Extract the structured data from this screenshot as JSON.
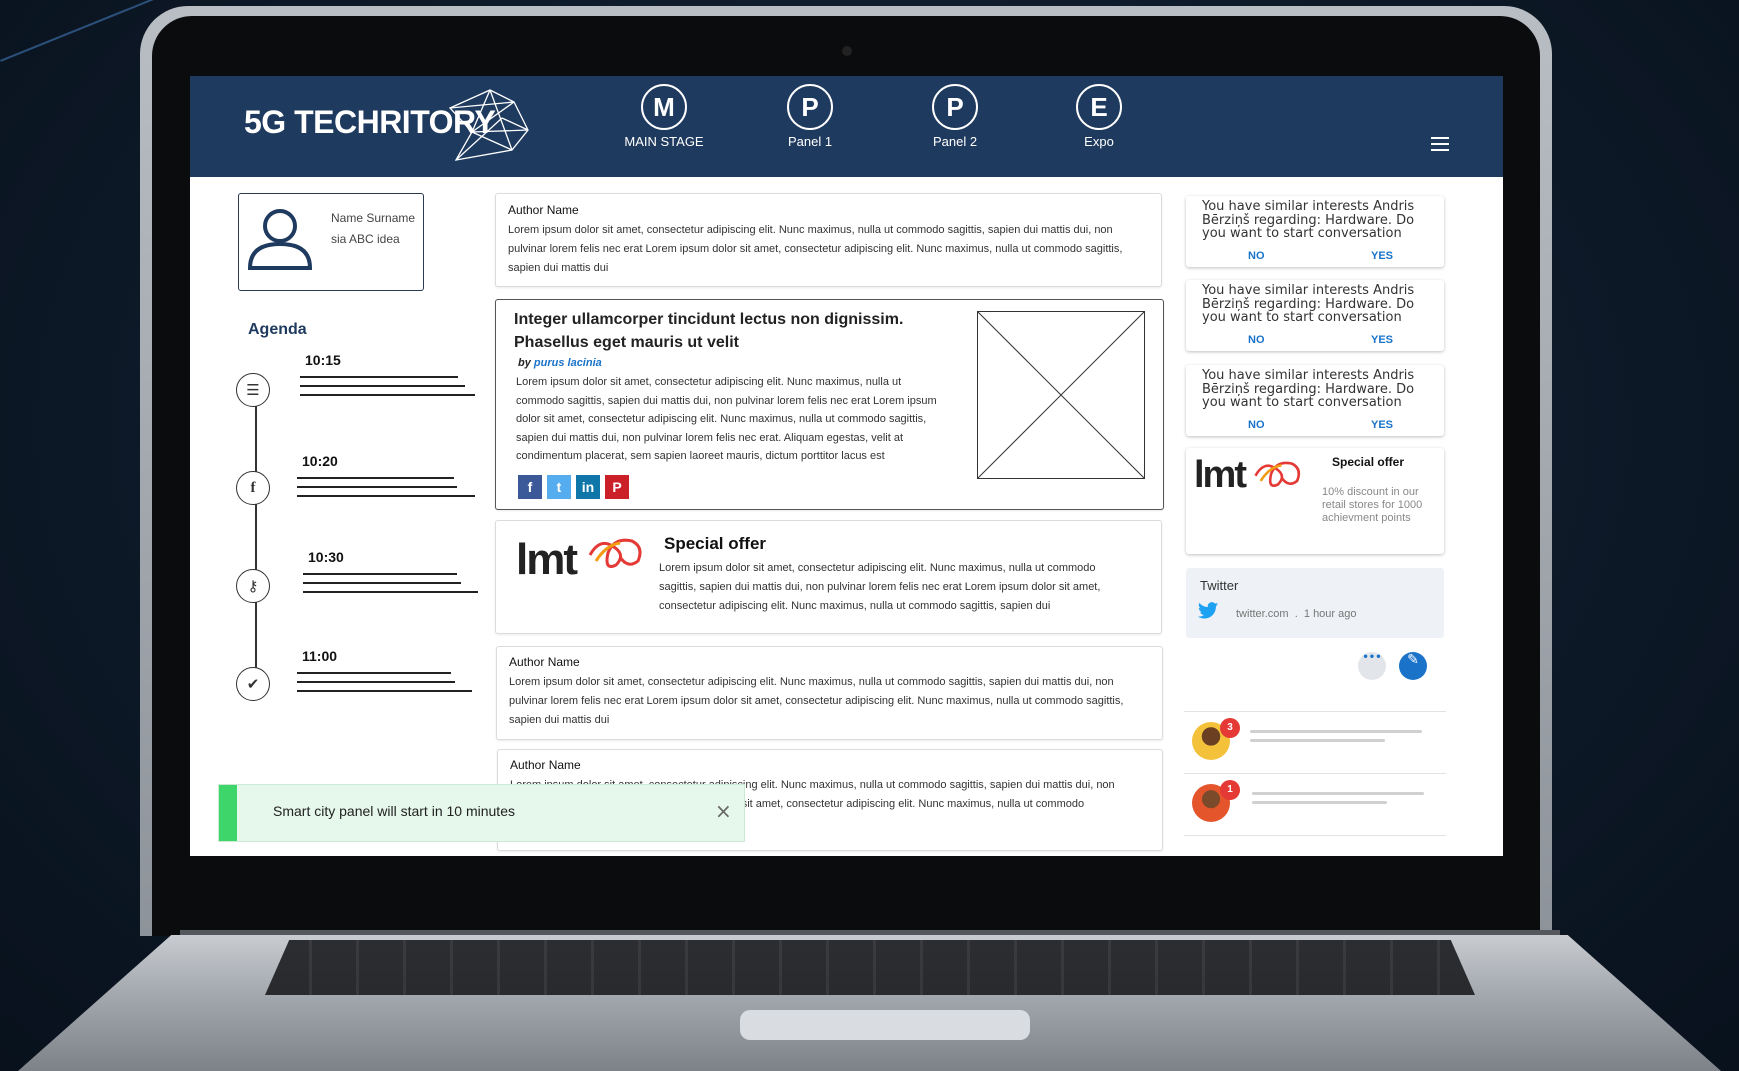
{
  "header": {
    "logo": "5G TECHRITORY",
    "nav": [
      {
        "letter": "M",
        "label": "MAIN STAGE"
      },
      {
        "letter": "P",
        "label": "Panel 1"
      },
      {
        "letter": "P",
        "label": "Panel 2"
      },
      {
        "letter": "E",
        "label": "Expo"
      }
    ],
    "menu_icon": "hamburger-icon"
  },
  "profile": {
    "name": "Name Surname",
    "company": "sia ABC idea",
    "icon": "user-icon"
  },
  "agenda": {
    "title": "Agenda",
    "items": [
      {
        "time": "10:15",
        "icon": "list-icon"
      },
      {
        "time": "10:20",
        "icon": "facebook-icon"
      },
      {
        "time": "10:30",
        "icon": "key-icon"
      },
      {
        "time": "11:00",
        "icon": "check-icon"
      }
    ]
  },
  "feed": {
    "post1": {
      "author": "Author Name",
      "text": "Lorem ipsum dolor sit amet, consectetur adipiscing elit. Nunc maximus, nulla ut commodo sagittis, sapien dui mattis dui, non pulvinar lorem felis nec erat Lorem ipsum dolor sit amet, consectetur adipiscing elit. Nunc maximus, nulla ut commodo sagittis, sapien dui mattis dui"
    },
    "featured": {
      "title": "Integer ullamcorper tincidunt lectus non dignissim. Phasellus eget mauris ut velit",
      "by": "by",
      "author": "purus lacinia",
      "text": "Lorem ipsum dolor sit amet, consectetur adipiscing elit. Nunc maximus, nulla ut commodo sagittis, sapien dui mattis dui, non pulvinar lorem felis nec erat Lorem ipsum dolor sit amet, consectetur adipiscing elit. Nunc maximus, nulla ut commodo sagittis, sapien dui mattis dui, non pulvinar lorem felis nec erat. Aliquam egestas, velit at condimentum placerat, sem sapien laoreet mauris, dictum porttitor lacus est",
      "social": [
        {
          "label": "f",
          "color": "#3b5998",
          "icon": "facebook-icon"
        },
        {
          "label": "t",
          "color": "#55acee",
          "icon": "twitter-icon"
        },
        {
          "label": "in",
          "color": "#0e76a8",
          "icon": "linkedin-icon"
        },
        {
          "label": "P",
          "color": "#cb2027",
          "icon": "pinterest-icon"
        }
      ]
    },
    "offer": {
      "brand": "lmt",
      "title": "Special offer",
      "text": "Lorem ipsum dolor sit amet, consectetur adipiscing elit. Nunc maximus, nulla ut commodo sagittis, sapien dui mattis dui, non pulvinar lorem felis nec erat Lorem ipsum dolor sit amet, consectetur adipiscing elit. Nunc maximus, nulla ut commodo sagittis, sapien dui"
    },
    "post2": {
      "author": "Author Name",
      "text": "Lorem ipsum dolor sit amet, consectetur adipiscing elit. Nunc maximus, nulla ut commodo sagittis, sapien dui mattis dui, non pulvinar lorem felis nec erat Lorem ipsum dolor sit amet, consectetur adipiscing elit. Nunc maximus, nulla ut commodo sagittis, sapien dui mattis dui"
    },
    "post3": {
      "author": "Author Name",
      "text": "Lorem ipsum dolor sit amet, consectetur adipiscing elit. Nunc maximus, nulla ut commodo sagittis, sapien dui mattis dui, non pulvinar lorem felis nec erat Lorem ipsum dolor sit amet, consectetur adipiscing elit. Nunc maximus, nulla ut commodo"
    }
  },
  "toast": {
    "text": "Smart city panel will start in 10 minutes",
    "close": "×"
  },
  "suggestions": [
    {
      "text": "You have similar interests Andris Bērziņš regarding: Hardware. Do you want to start conversation",
      "no": "NO",
      "yes": "YES"
    },
    {
      "text": "You have similar interests Andris Bērziņš regarding: Hardware. Do you want to start conversation",
      "no": "NO",
      "yes": "YES"
    },
    {
      "text": "You have similar interests Andris Bērziņš regarding: Hardware. Do you want to start conversation",
      "no": "NO",
      "yes": "YES"
    }
  ],
  "side_offer": {
    "brand": "lmt",
    "title": "Special offer",
    "text": "10% discount in our retail stores for 1000 achievment points"
  },
  "twitter": {
    "title": "Twitter",
    "source": "twitter.com",
    "sep": ".",
    "time": "1 hour ago"
  },
  "actions": {
    "more": "•••",
    "compose_icon": "edit-icon"
  },
  "chats": [
    {
      "badge": "3"
    },
    {
      "badge": "1"
    }
  ],
  "colors": {
    "header": "#1f3a5f",
    "accent": "#1a73c9",
    "toast": "#3ed66a",
    "badge": "#e53935"
  }
}
